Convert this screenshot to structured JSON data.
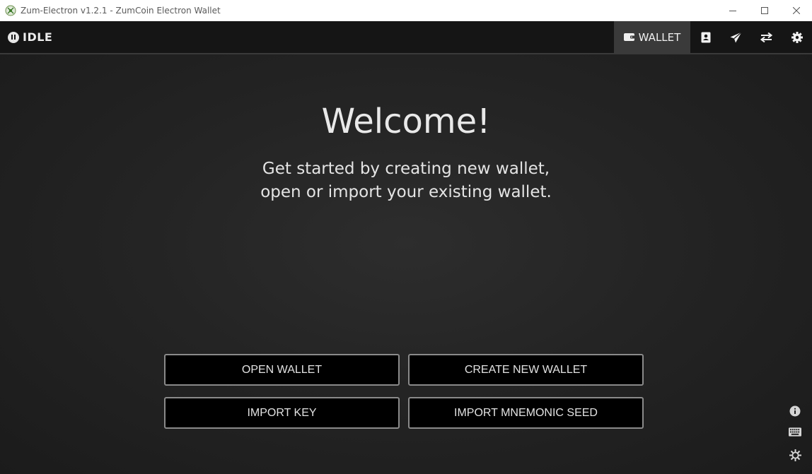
{
  "window": {
    "title": "Zum-Electron v1.2.1 - ZumCoin Electron Wallet",
    "icons": {
      "app": "zumcoin-logo-icon",
      "minimize": "minimize-icon",
      "maximize": "maximize-icon",
      "close": "close-icon"
    }
  },
  "header": {
    "status_text": "IDLE",
    "status_icon": "pause-icon",
    "nav": {
      "wallet_label": "WALLET",
      "wallet_icon": "wallet-icon",
      "addressbook_icon": "address-book-icon",
      "send_icon": "send-icon",
      "transfer_icon": "exchange-icon",
      "settings_icon": "gear-icon"
    }
  },
  "main": {
    "heading": "Welcome!",
    "subtitle_line1": "Get started by creating new wallet,",
    "subtitle_line2": "open or import your existing wallet.",
    "buttons": {
      "open_wallet": "OPEN WALLET",
      "create_wallet": "CREATE NEW WALLET",
      "import_key": "IMPORT KEY",
      "import_seed": "IMPORT MNEMONIC SEED"
    },
    "side_icons": [
      "info-icon",
      "keyboard-icon",
      "brightness-icon"
    ]
  },
  "colors": {
    "header_bg": "#151515",
    "active_tab_bg": "#3a3a3a",
    "button_bg": "#000000",
    "button_border": "#8a8a8a",
    "text": "#e9e9e9"
  }
}
